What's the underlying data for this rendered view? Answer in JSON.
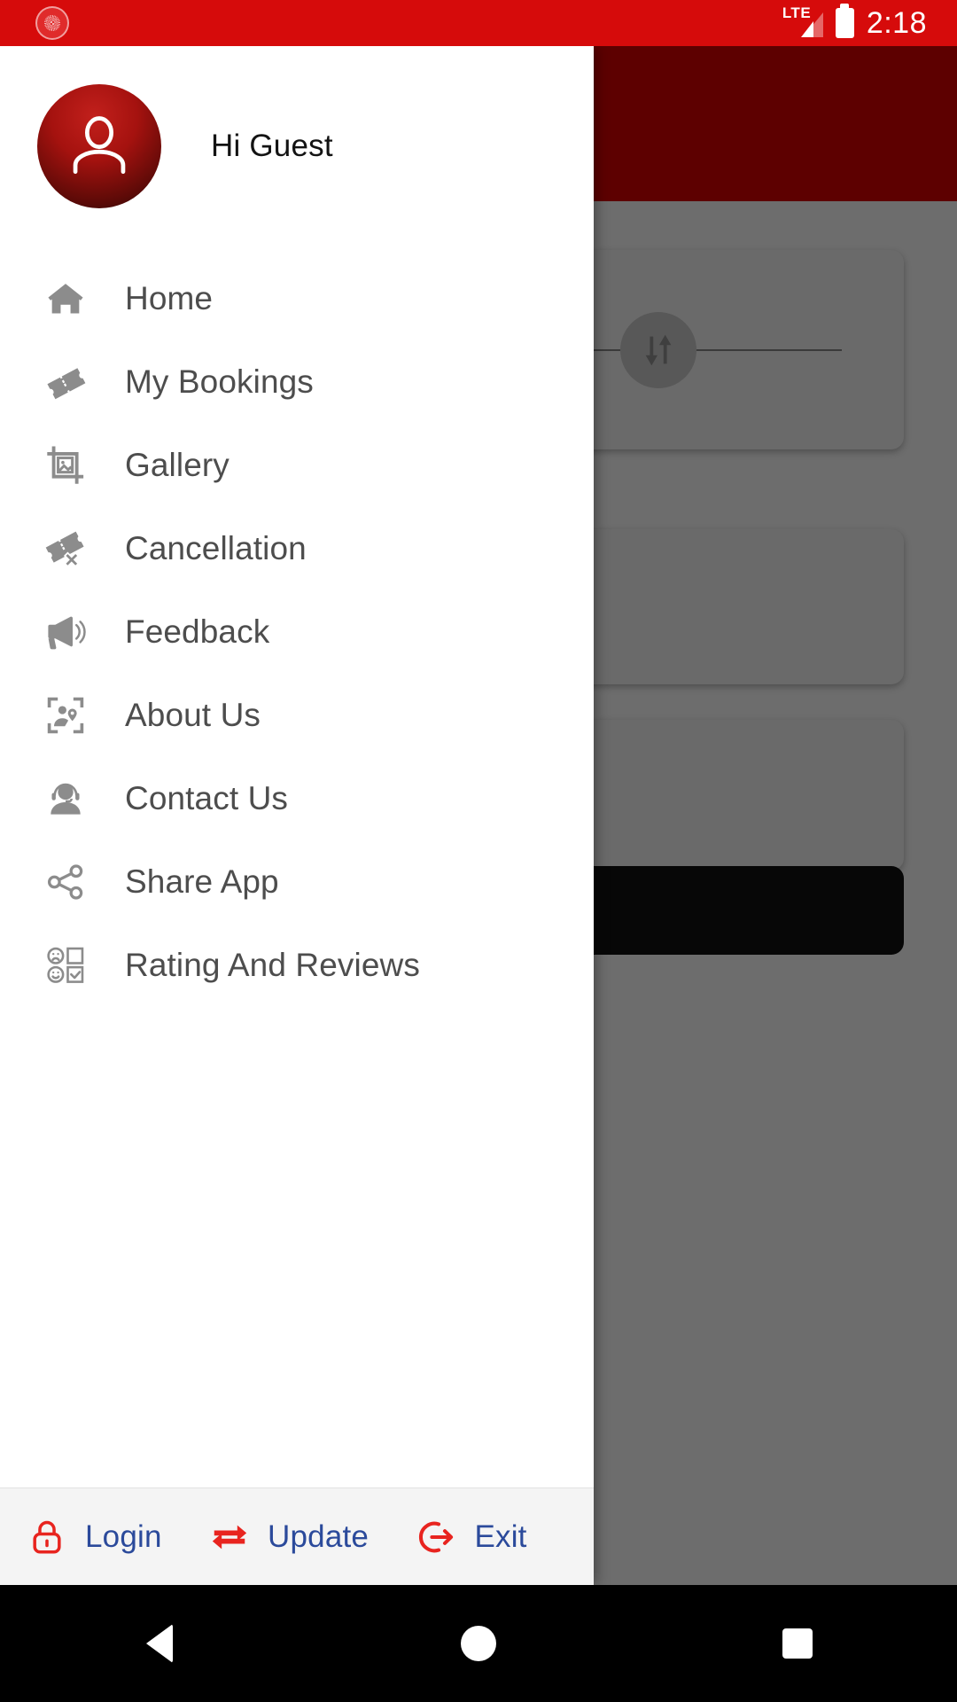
{
  "status_bar": {
    "app_icon": "app-logo-icon",
    "network_label": "LTE",
    "signal_icon": "signal-bars-icon",
    "battery_icon": "battery-full-icon",
    "time": "2:18"
  },
  "drawer": {
    "profile": {
      "avatar_icon": "user-avatar-icon",
      "greeting": "Hi Guest"
    },
    "menu_items": [
      {
        "label": "Home",
        "icon": "home-icon"
      },
      {
        "label": "My Bookings",
        "icon": "ticket-icon"
      },
      {
        "label": "Gallery",
        "icon": "gallery-image-icon"
      },
      {
        "label": "Cancellation",
        "icon": "ticket-cancel-icon"
      },
      {
        "label": "Feedback",
        "icon": "megaphone-icon"
      },
      {
        "label": "About Us",
        "icon": "person-location-frame-icon"
      },
      {
        "label": "Contact Us",
        "icon": "headset-support-icon"
      },
      {
        "label": "Share App",
        "icon": "share-nodes-icon"
      },
      {
        "label": "Rating And Reviews",
        "icon": "survey-smiley-checkbox-icon"
      }
    ],
    "footer_actions": [
      {
        "label": "Login",
        "icon": "lock-icon"
      },
      {
        "label": "Update",
        "icon": "swap-arrows-icon"
      },
      {
        "label": "Exit",
        "icon": "exit-arrow-icon"
      }
    ]
  },
  "background_app": {
    "swap_button_icon": "swap-vertical-icon"
  },
  "navigation_bar": {
    "back_icon": "nav-back-triangle-icon",
    "home_icon": "nav-home-circle-icon",
    "recents_icon": "nav-recents-square-icon"
  },
  "colors": {
    "status_bar": "#d60b0b",
    "app_header": "#5d0000",
    "scrim": "#6d6d6d",
    "drawer_bg": "#ffffff",
    "menu_icon": "#8c8c8c",
    "menu_text": "#4d4d4d",
    "footer_bg": "#f4f4f4",
    "footer_icon": "#e8241f",
    "footer_text": "#2b4a9b",
    "nav_bar": "#000000"
  }
}
